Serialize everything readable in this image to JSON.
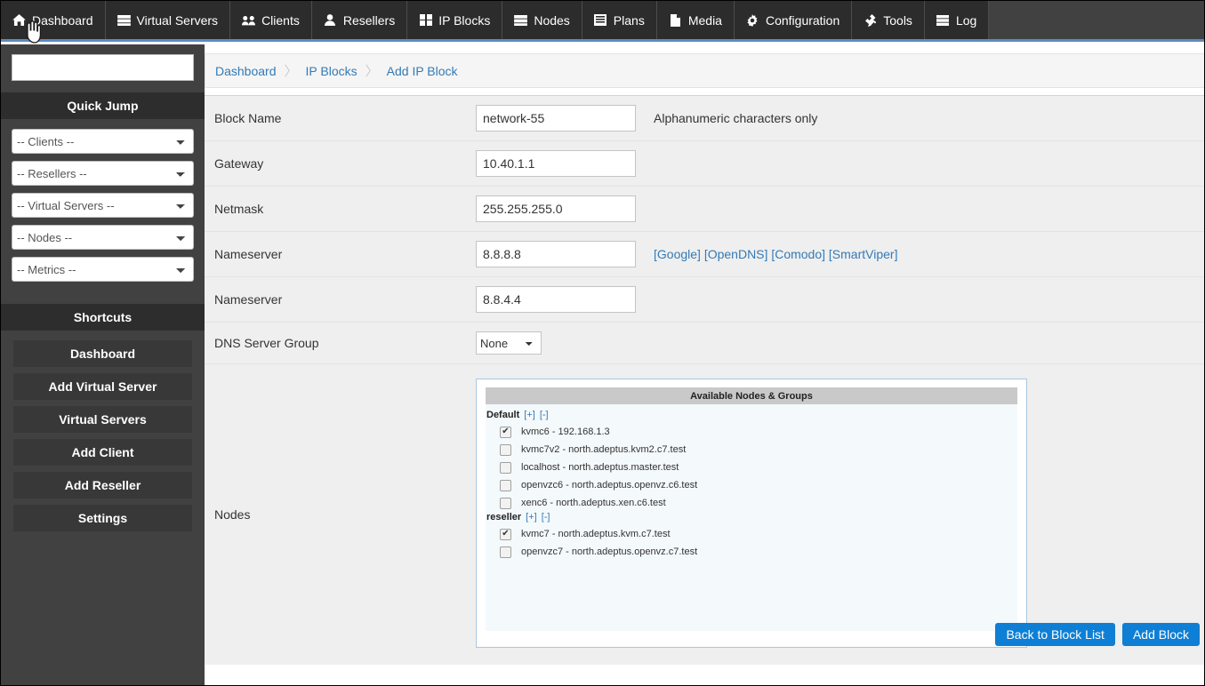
{
  "nav": {
    "items": [
      {
        "label": "Dashboard",
        "icon": "home-icon"
      },
      {
        "label": "Virtual Servers",
        "icon": "server-icon"
      },
      {
        "label": "Clients",
        "icon": "users-icon"
      },
      {
        "label": "Resellers",
        "icon": "user-icon"
      },
      {
        "label": "IP Blocks",
        "icon": "grid-icon"
      },
      {
        "label": "Nodes",
        "icon": "stack-icon"
      },
      {
        "label": "Plans",
        "icon": "list-icon"
      },
      {
        "label": "Media",
        "icon": "file-icon"
      },
      {
        "label": "Configuration",
        "icon": "gear-icon"
      },
      {
        "label": "Tools",
        "icon": "wrench-icon"
      },
      {
        "label": "Log",
        "icon": "log-icon"
      }
    ]
  },
  "sidebar": {
    "search": {
      "value": "",
      "placeholder": ""
    },
    "quick_jump": {
      "title": "Quick Jump",
      "selects": [
        {
          "name": "clients",
          "value": "-- Clients --"
        },
        {
          "name": "resellers",
          "value": "-- Resellers --"
        },
        {
          "name": "virtual-servers",
          "value": "-- Virtual Servers --"
        },
        {
          "name": "nodes",
          "value": "-- Nodes --"
        },
        {
          "name": "metrics",
          "value": "-- Metrics --"
        }
      ]
    },
    "shortcuts": {
      "title": "Shortcuts",
      "items": [
        {
          "label": "Dashboard"
        },
        {
          "label": "Add Virtual Server"
        },
        {
          "label": "Virtual Servers"
        },
        {
          "label": "Add Client"
        },
        {
          "label": "Add Reseller"
        },
        {
          "label": "Settings"
        }
      ]
    }
  },
  "breadcrumb": {
    "items": [
      {
        "label": "Dashboard"
      },
      {
        "label": "IP Blocks"
      },
      {
        "label": "Add IP Block"
      }
    ],
    "separator": "〉"
  },
  "form": {
    "rows": [
      {
        "label": "Block Name",
        "value": "network-55",
        "hint": "Alphanumeric characters only"
      },
      {
        "label": "Gateway",
        "value": "10.40.1.1",
        "hint": ""
      },
      {
        "label": "Netmask",
        "value": "255.255.255.0",
        "hint": ""
      },
      {
        "label": "Nameserver",
        "value": "8.8.8.8",
        "hint": ""
      },
      {
        "label": "Nameserver",
        "value": "8.8.4.4",
        "hint": ""
      }
    ],
    "dns_links": [
      {
        "label": "[Google]"
      },
      {
        "label": "[OpenDNS]"
      },
      {
        "label": "[Comodo]"
      },
      {
        "label": "[SmartViper]"
      }
    ],
    "dns_server_group": {
      "label": "DNS Server Group",
      "value": "None"
    },
    "nodes": {
      "label": "Nodes",
      "panel_title": "Available Nodes & Groups",
      "expand_label": "[+]",
      "collapse_label": "[-]",
      "groups": [
        {
          "name": "Default",
          "nodes": [
            {
              "label": "kvmc6 - 192.168.1.3",
              "checked": true
            },
            {
              "label": "kvmc7v2 - north.adeptus.kvm2.c7.test",
              "checked": false
            },
            {
              "label": "localhost - north.adeptus.master.test",
              "checked": false
            },
            {
              "label": "openvzc6 - north.adeptus.openvz.c6.test",
              "checked": false
            },
            {
              "label": "xenc6 - north.adeptus.xen.c6.test",
              "checked": false
            }
          ]
        },
        {
          "name": "reseller",
          "nodes": [
            {
              "label": "kvmc7 - north.adeptus.kvm.c7.test",
              "checked": true
            },
            {
              "label": "openvzc7 - north.adeptus.openvz.c7.test",
              "checked": false
            }
          ]
        }
      ]
    }
  },
  "actions": {
    "back_label": "Back to Block List",
    "add_label": "Add Block"
  },
  "colors": {
    "nav_bg": "#414141",
    "nav_item_bg": "#2c2c2c",
    "nav_accent": "#5b8cc0",
    "link": "#337ab7",
    "button": "#0e7fd4",
    "row_bg": "#efefef",
    "panel_border": "#a9c7e2"
  }
}
